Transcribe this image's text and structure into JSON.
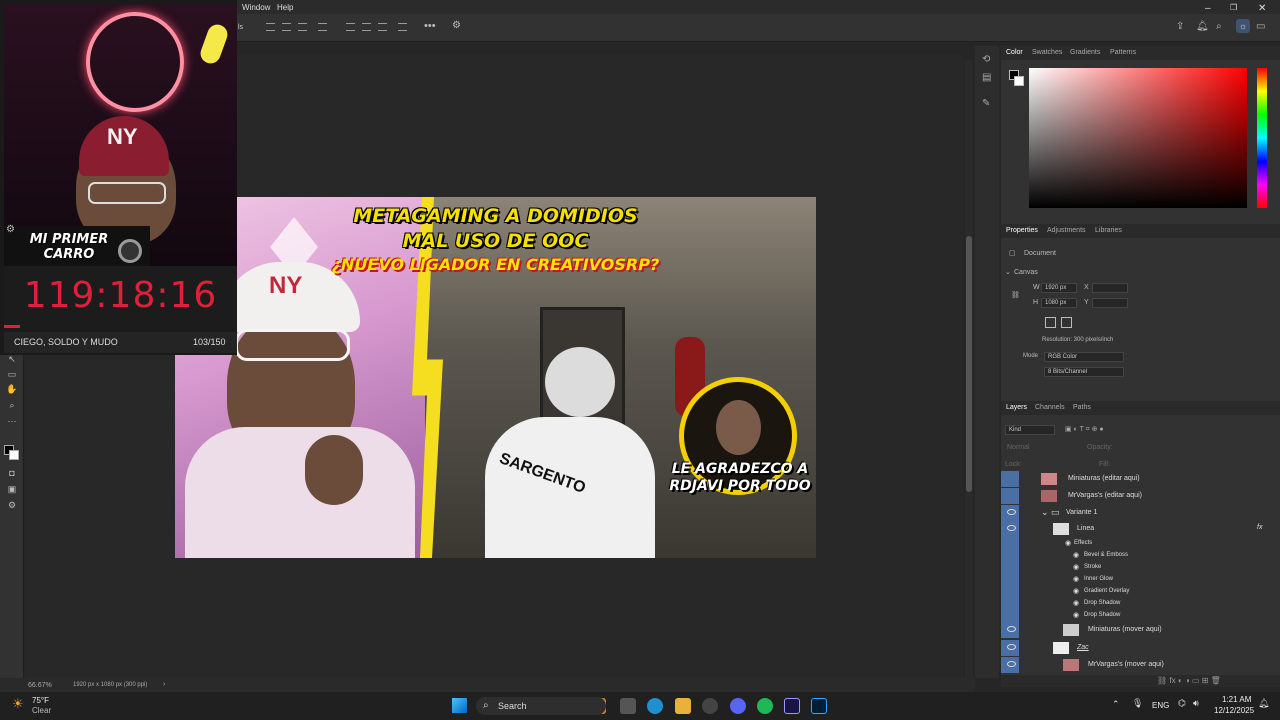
{
  "menu": {
    "window": "Window",
    "help": "Help",
    "cut_label": "ls"
  },
  "stream_overlay": {
    "badge": "MI PRIMER CARRO",
    "timer": "119:18:16",
    "goal_label": "CIEGO, SOLDO Y MUDO",
    "goal_count": "103/150",
    "progress_fraction": 0.07
  },
  "thumbnail": {
    "line1": "METAGAMING A DOMIDIOS",
    "line2": "MAL USO DE OOC",
    "line3": "¿NUEVO LIGADOR EN CREATIVOSRP?",
    "thanks": "LE AGRADEZCO A RDJAVI POR TODO",
    "jersey": "SARGENTO",
    "cap": "NY"
  },
  "color_panel": {
    "tabs": [
      "Color",
      "Swatches",
      "Gradients",
      "Patterns"
    ]
  },
  "properties_panel": {
    "tabs": [
      "Properties",
      "Adjustments",
      "Libraries"
    ],
    "doc_label": "Document",
    "canvas_label": "Canvas",
    "w_label": "W",
    "w_value": "1920 px",
    "h_label": "H",
    "h_value": "1080 px",
    "x_label": "X",
    "y_label": "Y",
    "resolution": "Resolution: 300 pixels/inch",
    "mode_label": "Mode",
    "mode_value": "RGB Color",
    "depth_value": "8 Bits/Channel"
  },
  "layers_panel": {
    "tabs": [
      "Layers",
      "Channels",
      "Paths"
    ],
    "kind": "Kind",
    "blend": "Normal",
    "opacity": "Opacity:",
    "lock": "Lock:",
    "fill": "Fill:",
    "layers": [
      {
        "name": "Miniaturas (editar aqui)",
        "visible": false
      },
      {
        "name": "MrVargas's (editar aqui)",
        "visible": false
      },
      {
        "name": "Variante 1",
        "visible": true
      },
      {
        "name": "Linea",
        "visible": true,
        "fx": "fx"
      },
      {
        "name": "Effects",
        "visible": false
      },
      {
        "name": "Bevel & Emboss",
        "visible": false
      },
      {
        "name": "Stroke",
        "visible": false
      },
      {
        "name": "Inner Glow",
        "visible": false
      },
      {
        "name": "Gradient Overlay",
        "visible": false
      },
      {
        "name": "Drop Shadow",
        "visible": false
      },
      {
        "name": "Drop Shadow",
        "visible": false
      },
      {
        "name": "Miniaturas (mover aqui)",
        "visible": true
      },
      {
        "name": "Zac",
        "visible": true
      },
      {
        "name": "MrVargas's (mover aqui)",
        "visible": true
      }
    ]
  },
  "status": {
    "zoom": "66.67%",
    "doc_info": "1920 px x 1080 px (300 ppi)"
  },
  "taskbar": {
    "weather_temp": "75°F",
    "weather_desc": "Clear",
    "search": "Search",
    "lang": "ENG",
    "time": "1:21 AM",
    "date": "12/12/2025"
  }
}
